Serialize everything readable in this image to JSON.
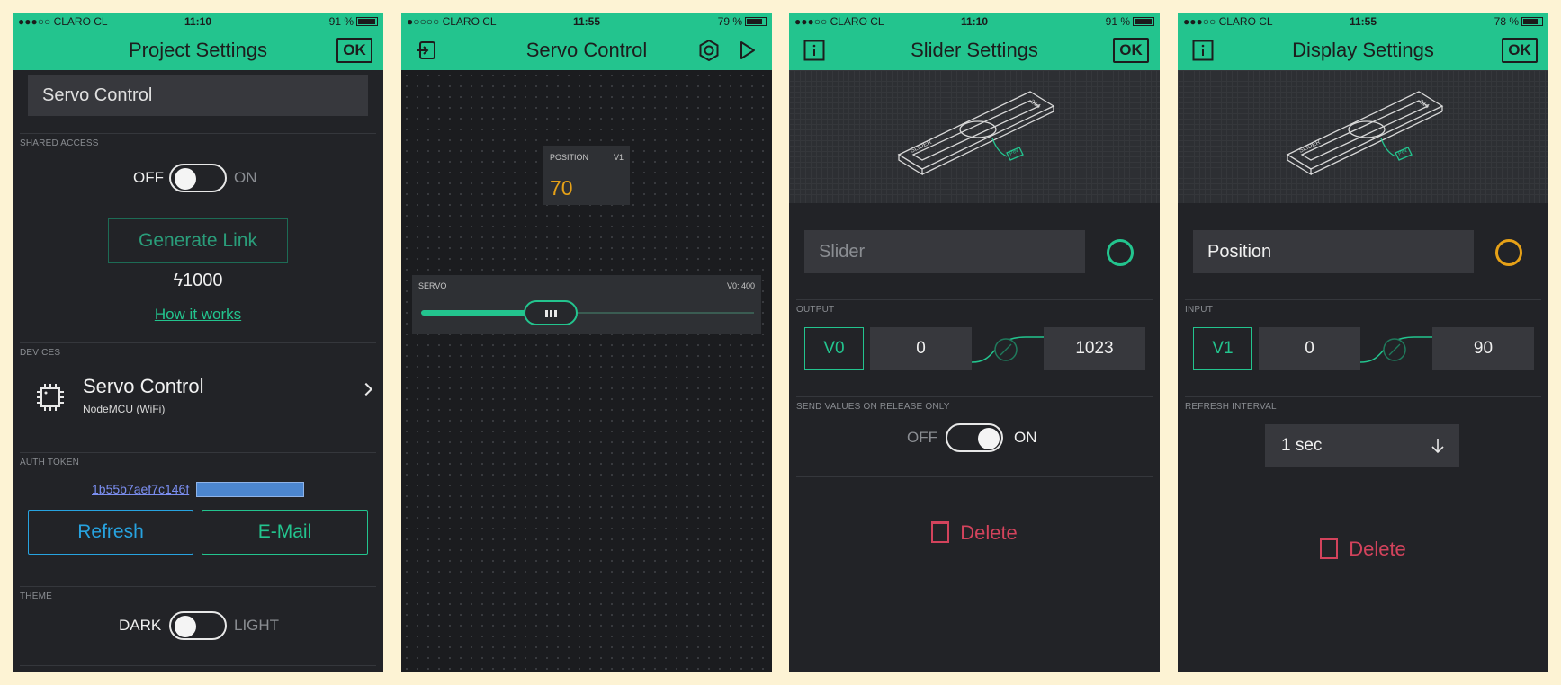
{
  "colors": {
    "accent": "#23c48e",
    "background": "#fdf3d4",
    "panel": "#222327",
    "delete": "#d3435c",
    "link_blue": "#7b8ef0",
    "refresh_blue": "#27a3e0",
    "orange": "#e6a117"
  },
  "panels": [
    {
      "status": {
        "carrier": "●●●○○ CLARO CL",
        "time": "11:10",
        "battery": "91 %"
      },
      "header": {
        "title": "Project Settings",
        "ok_label": "OK"
      },
      "project_name": "Servo Control",
      "shared_access": {
        "label": "SHARED ACCESS",
        "off_label": "OFF",
        "on_label": "ON",
        "generate_label": "Generate Link",
        "energy": "1000",
        "how_label": "How it works"
      },
      "devices": {
        "label": "DEVICES",
        "name": "Servo Control",
        "type": "NodeMCU (WiFi)"
      },
      "auth": {
        "label": "AUTH TOKEN",
        "token": "1b55b7aef7c146f",
        "refresh_label": "Refresh",
        "email_label": "E-Mail"
      },
      "theme": {
        "label": "THEME",
        "dark_label": "DARK",
        "light_label": "LIGHT"
      }
    },
    {
      "status": {
        "carrier": "●○○○○ CLARO CL",
        "time": "11:55",
        "battery": "79 %"
      },
      "header": {
        "title": "Servo Control"
      },
      "display_widget": {
        "label": "POSITION",
        "pin": "V1",
        "value": "70"
      },
      "slider_widget": {
        "label": "SERVO",
        "pin_value": "V0: 400",
        "level": 0.39
      }
    },
    {
      "status": {
        "carrier": "●●●○○ CLARO CL",
        "time": "11:10",
        "battery": "91 %"
      },
      "header": {
        "title": "Slider Settings",
        "ok_label": "OK"
      },
      "name_placeholder": "Slider",
      "output": {
        "label": "OUTPUT",
        "pin": "V0",
        "min": "0",
        "max": "1023"
      },
      "send_release": {
        "label": "SEND VALUES ON RELEASE ONLY",
        "off_label": "OFF",
        "on_label": "ON"
      },
      "delete_label": "Delete"
    },
    {
      "status": {
        "carrier": "●●●○○ CLARO CL",
        "time": "11:55",
        "battery": "78 %"
      },
      "header": {
        "title": "Display Settings",
        "ok_label": "OK"
      },
      "name_value": "Position",
      "input": {
        "label": "INPUT",
        "pin": "V1",
        "min": "0",
        "max": "90"
      },
      "refresh": {
        "label": "REFRESH INTERVAL",
        "value": "1 sec"
      },
      "delete_label": "Delete"
    }
  ]
}
